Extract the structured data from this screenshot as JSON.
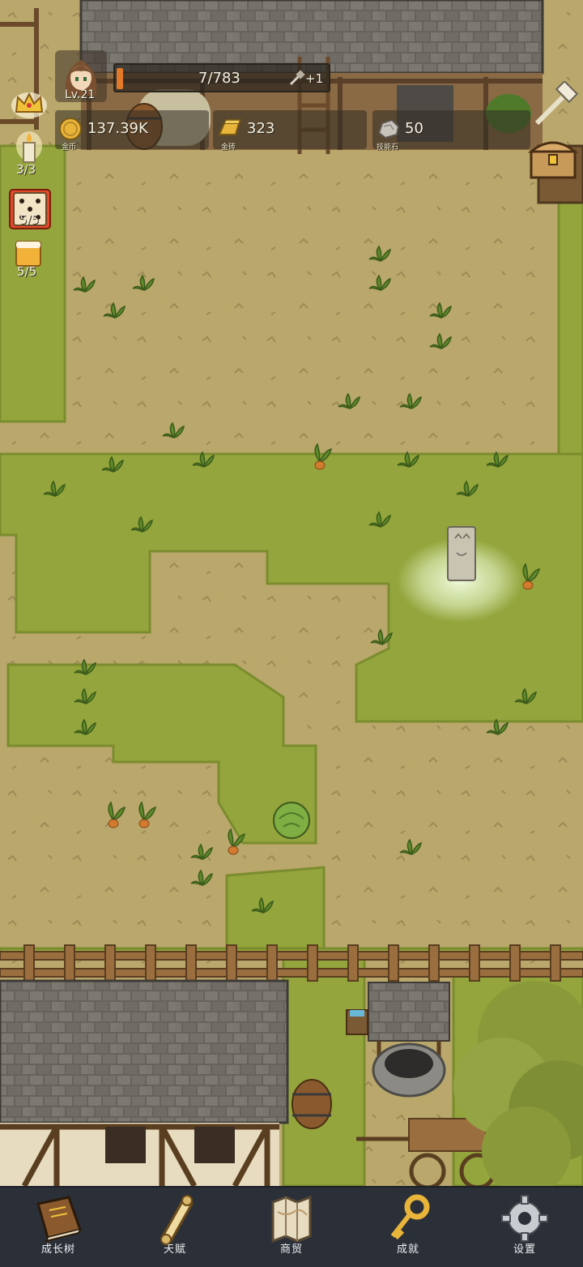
{
  "player": {
    "level": "Lv.21",
    "xp_text": "7/783",
    "xp_progress": 0.009,
    "bonus_text": "+1"
  },
  "resources": [
    {
      "name": "gold",
      "value": "137.39K",
      "label": "金币",
      "icon": "gold-coin-icon"
    },
    {
      "name": "gold-brick",
      "value": "323",
      "label": "金砖",
      "icon": "gold-bar-icon"
    },
    {
      "name": "skill-stone",
      "value": "50",
      "label": "技能石",
      "icon": "stone-icon"
    }
  ],
  "side_counters": [
    {
      "name": "candle",
      "value": "3/3",
      "icon": "candle-icon"
    },
    {
      "name": "dice",
      "value": "5/5",
      "icon": "dice-icon"
    },
    {
      "name": "beer",
      "value": "5/5",
      "icon": "beer-icon"
    }
  ],
  "nav": [
    {
      "name": "growth-tree",
      "label": "成长树",
      "icon": "book-icon"
    },
    {
      "name": "talent",
      "label": "天赋",
      "icon": "scroll-icon"
    },
    {
      "name": "trade",
      "label": "商贸",
      "icon": "map-icon"
    },
    {
      "name": "achievement",
      "label": "成就",
      "icon": "key-icon"
    },
    {
      "name": "settings",
      "label": "设置",
      "icon": "gear-icon"
    }
  ],
  "colors": {
    "dirt": "#b8a66a",
    "grass": "#8fa23a",
    "nav_bg": "#2b3038",
    "roof": "#6e6a64"
  }
}
